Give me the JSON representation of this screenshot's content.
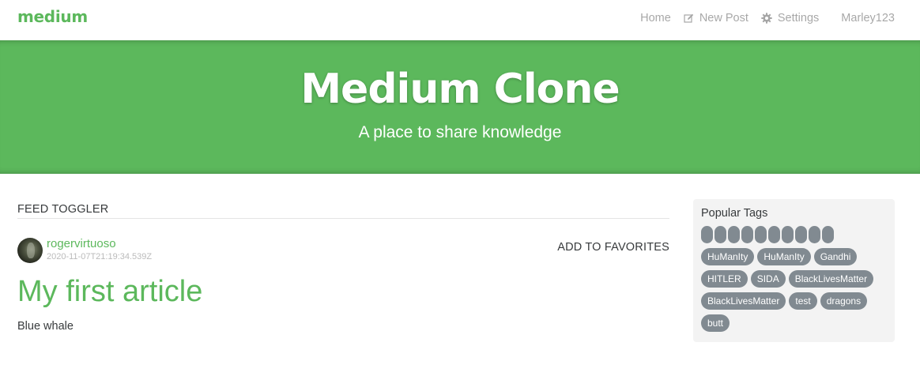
{
  "navbar": {
    "brand": "medium",
    "links": {
      "home": "Home",
      "new_post": "New Post",
      "settings": "Settings",
      "user": "Marley123"
    }
  },
  "banner": {
    "title": "Medium Clone",
    "subtitle": "A place to share knowledge"
  },
  "feed": {
    "toggler_label": "FEED TOGGLER",
    "articles": [
      {
        "author": "rogervirtuoso",
        "date": "2020-11-07T21:19:34.539Z",
        "favorite_label": "ADD TO FAVORITES",
        "title": "My first article",
        "description": "Blue whale"
      }
    ]
  },
  "sidebar": {
    "title": "Popular Tags",
    "empty_tag_count": 10,
    "tags": [
      "HuManIty",
      "HuManIty",
      "Gandhi",
      "HITLER",
      "SIDA",
      "BlackLivesMatter",
      "BlackLivesMatter",
      "test",
      "dragons",
      "butt"
    ]
  },
  "colors": {
    "brand": "#5cb85c",
    "tag_bg": "#818a91",
    "sidebar_bg": "#f3f3f3"
  },
  "icons": {
    "new_post": "edit-icon",
    "settings": "gear-icon"
  }
}
